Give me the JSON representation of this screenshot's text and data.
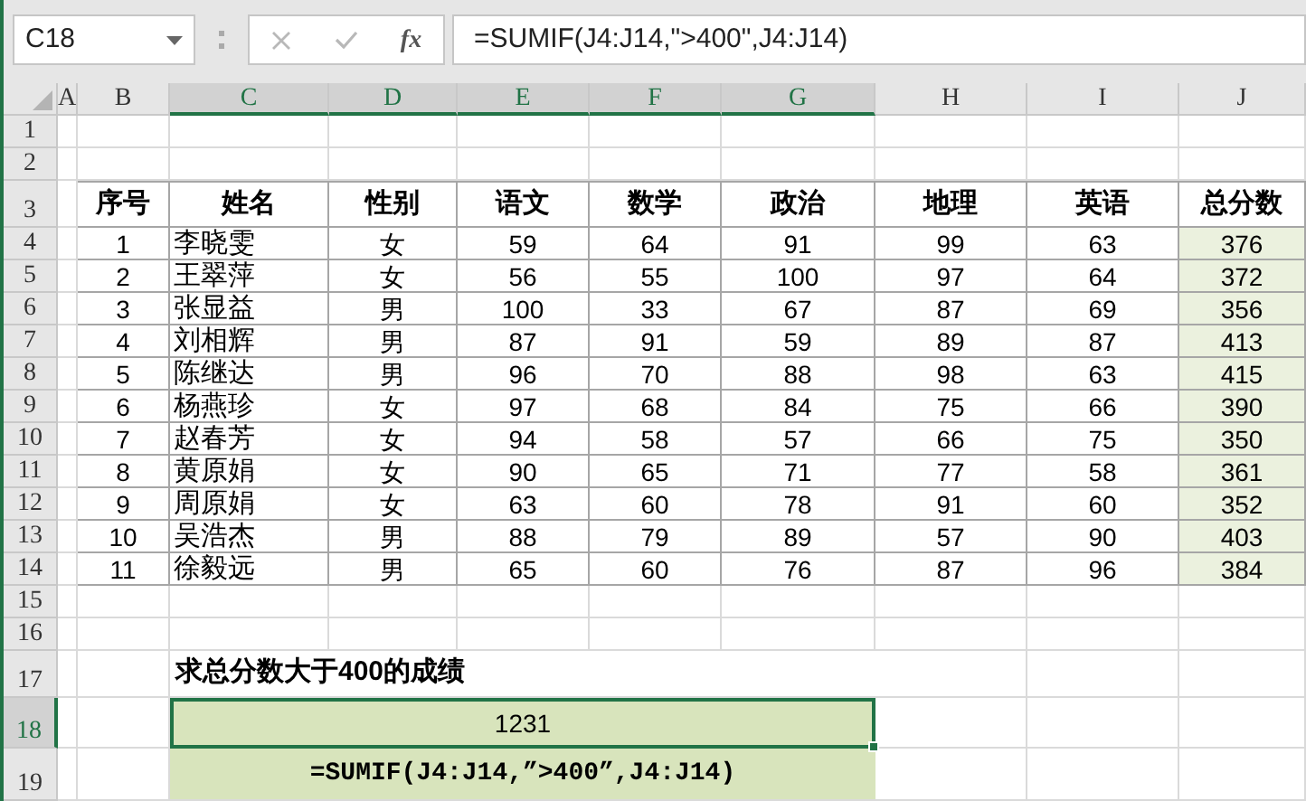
{
  "name_box": {
    "value": "C18"
  },
  "formula_bar": {
    "function_label": "fx",
    "formula": "=SUMIF(J4:J14,\">400\",J4:J14)"
  },
  "columns": [
    {
      "label": "A",
      "selected": false
    },
    {
      "label": "B",
      "selected": false
    },
    {
      "label": "C",
      "selected": true
    },
    {
      "label": "D",
      "selected": true
    },
    {
      "label": "E",
      "selected": true
    },
    {
      "label": "F",
      "selected": true
    },
    {
      "label": "G",
      "selected": true
    },
    {
      "label": "H",
      "selected": false
    },
    {
      "label": "I",
      "selected": false
    },
    {
      "label": "J",
      "selected": false
    }
  ],
  "row_headers": [
    {
      "label": "1",
      "selected": false
    },
    {
      "label": "2",
      "selected": false
    },
    {
      "label": "3",
      "selected": false
    },
    {
      "label": "4",
      "selected": false
    },
    {
      "label": "5",
      "selected": false
    },
    {
      "label": "6",
      "selected": false
    },
    {
      "label": "7",
      "selected": false
    },
    {
      "label": "8",
      "selected": false
    },
    {
      "label": "9",
      "selected": false
    },
    {
      "label": "10",
      "selected": false
    },
    {
      "label": "11",
      "selected": false
    },
    {
      "label": "12",
      "selected": false
    },
    {
      "label": "13",
      "selected": false
    },
    {
      "label": "14",
      "selected": false
    },
    {
      "label": "15",
      "selected": false
    },
    {
      "label": "16",
      "selected": false
    },
    {
      "label": "17",
      "selected": false
    },
    {
      "label": "18",
      "selected": true
    },
    {
      "label": "19",
      "selected": false
    }
  ],
  "table": {
    "columns": [
      "序号",
      "姓名",
      "性别",
      "语文",
      "数学",
      "政治",
      "地理",
      "英语",
      "总分数"
    ],
    "rows": [
      [
        "1",
        "李晓雯",
        "女",
        "59",
        "64",
        "91",
        "99",
        "63",
        "376"
      ],
      [
        "2",
        "王翠萍",
        "女",
        "56",
        "55",
        "100",
        "97",
        "64",
        "372"
      ],
      [
        "3",
        "张显益",
        "男",
        "100",
        "33",
        "67",
        "87",
        "69",
        "356"
      ],
      [
        "4",
        "刘相辉",
        "男",
        "87",
        "91",
        "59",
        "89",
        "87",
        "413"
      ],
      [
        "5",
        "陈继达",
        "男",
        "96",
        "70",
        "88",
        "98",
        "63",
        "415"
      ],
      [
        "6",
        "杨燕珍",
        "女",
        "97",
        "68",
        "84",
        "75",
        "66",
        "390"
      ],
      [
        "7",
        "赵春芳",
        "女",
        "94",
        "58",
        "57",
        "66",
        "75",
        "350"
      ],
      [
        "8",
        "黄原娟",
        "女",
        "90",
        "65",
        "71",
        "77",
        "58",
        "361"
      ],
      [
        "9",
        "周原娟",
        "女",
        "63",
        "60",
        "78",
        "91",
        "60",
        "352"
      ],
      [
        "10",
        "吴浩杰",
        "男",
        "88",
        "79",
        "89",
        "57",
        "90",
        "403"
      ],
      [
        "11",
        "徐毅远",
        "男",
        "65",
        "60",
        "76",
        "87",
        "96",
        "384"
      ]
    ]
  },
  "note": "求总分数大于400的成绩",
  "result": {
    "value": "1231",
    "selected": true
  },
  "formula_text": "=SUMIF(J4:J14,”>400”,J4:J14)"
}
